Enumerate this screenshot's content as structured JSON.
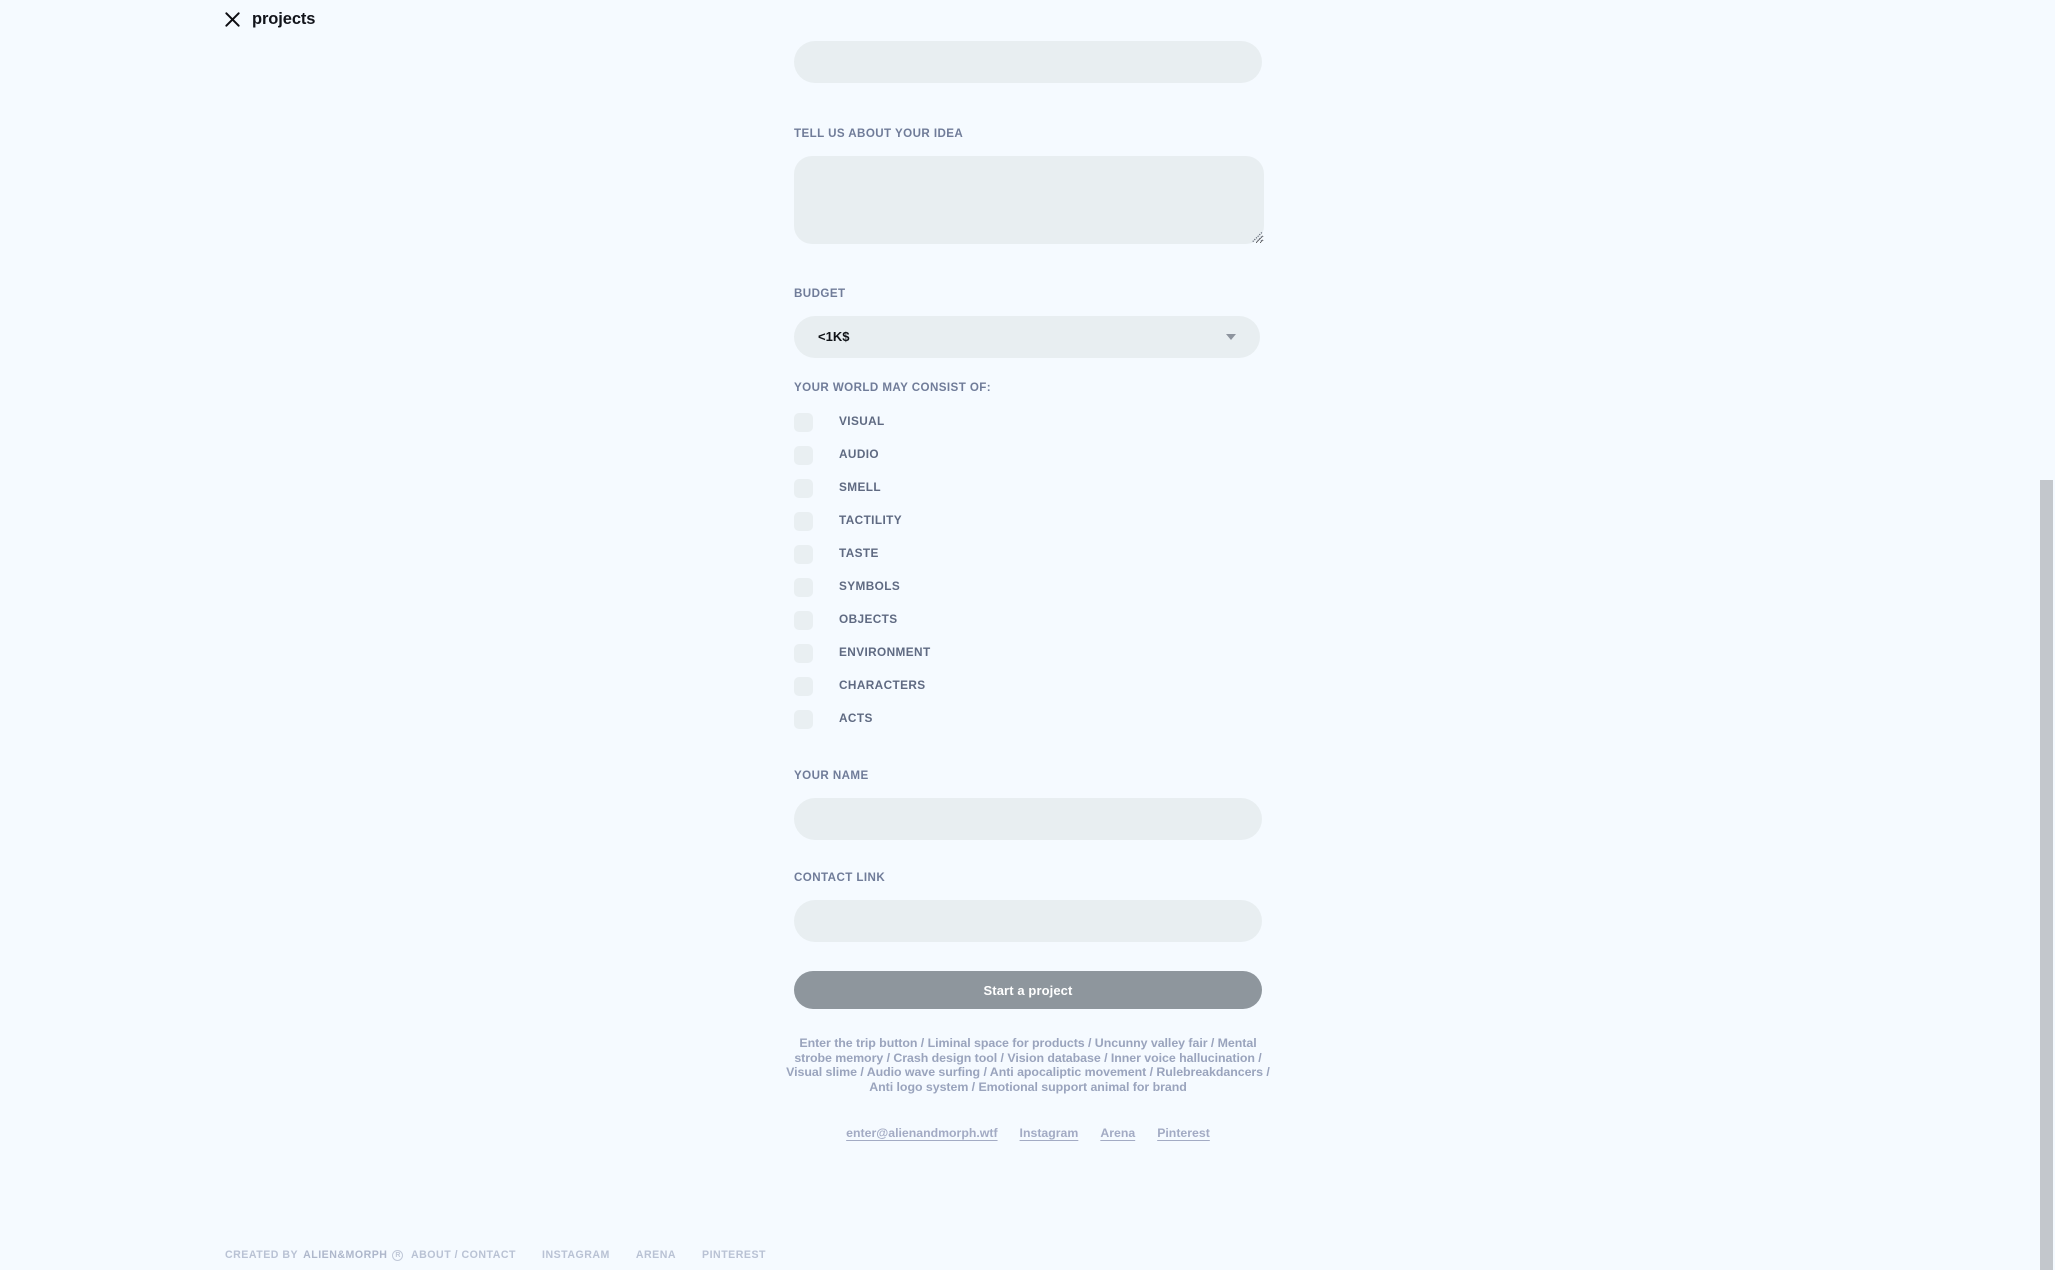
{
  "topbar": {
    "close_icon": "close-icon",
    "label": "projects"
  },
  "form": {
    "top_field": {
      "value": "",
      "placeholder": ""
    },
    "idea": {
      "label": "TELL US ABOUT YOUR IDEA",
      "value": "",
      "placeholder": ""
    },
    "budget": {
      "label": "BUDGET",
      "selected": "<1K$",
      "options": [
        "<1K$"
      ],
      "caret_icon": "chevron-down-icon"
    },
    "world": {
      "label": "YOUR WORLD MAY CONSIST OF:",
      "options": [
        {
          "label": "VISUAL",
          "checked": false
        },
        {
          "label": "AUDIO",
          "checked": false
        },
        {
          "label": "SMELL",
          "checked": false
        },
        {
          "label": "TACTILITY",
          "checked": false
        },
        {
          "label": "TASTE",
          "checked": false
        },
        {
          "label": "SYMBOLS",
          "checked": false
        },
        {
          "label": "OBJECTS",
          "checked": false
        },
        {
          "label": "ENVIRONMENT",
          "checked": false
        },
        {
          "label": "CHARACTERS",
          "checked": false
        },
        {
          "label": "ACTS",
          "checked": false
        }
      ]
    },
    "name": {
      "label": "YOUR NAME",
      "value": "",
      "placeholder": ""
    },
    "contact": {
      "label": "CONTACT LINK",
      "value": "",
      "placeholder": ""
    },
    "submit_label": "Start a project"
  },
  "tagline": "Enter the trip button / Liminal space for products / Uncunny valley fair / Mental strobe memory / Crash design tool / Vision database / Inner voice hallucination / Visual slime / Audio wave surfing / Anti apocaliptic movement / Rulebreakdancers / Anti logo system / Emotional support animal for brand",
  "links": [
    {
      "label": "enter@alienandmorph.wtf"
    },
    {
      "label": "Instagram"
    },
    {
      "label": "Arena"
    },
    {
      "label": "Pinterest"
    }
  ],
  "footer": {
    "created_by": "CREATED BY",
    "brand": "ALIEN&MORPH",
    "reg_mark": "R",
    "nav": [
      {
        "label": "ABOUT / CONTACT"
      },
      {
        "label": "INSTAGRAM"
      },
      {
        "label": "ARENA"
      },
      {
        "label": "PINTEREST"
      }
    ]
  },
  "colors": {
    "page_background": "#f5faff",
    "field_background": "#e8eef1",
    "label_text": "#707c99",
    "submit_background": "#8e969d",
    "submit_text": "#ffffff",
    "tagline_text": "#9aa4bd",
    "link_text": "#a3abc4",
    "footer_text": "#b9c2d4",
    "scrollbar_thumb": "#c3c7cc"
  }
}
